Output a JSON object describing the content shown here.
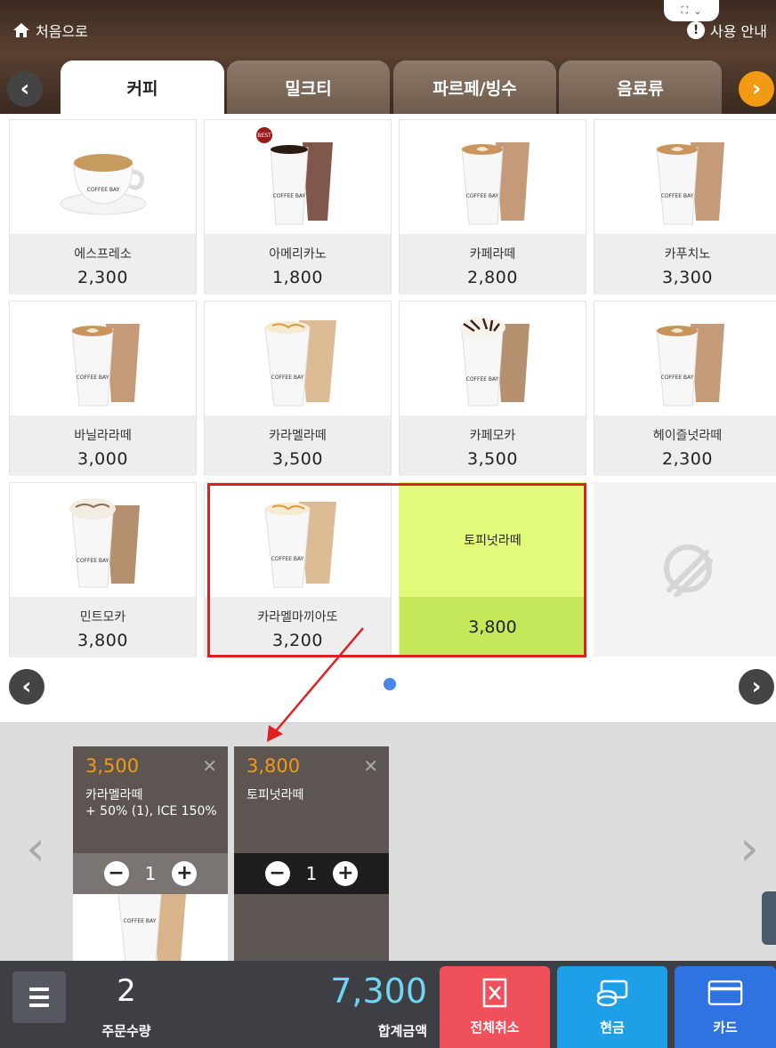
{
  "header": {
    "home_label": "처음으로",
    "help_label": "사용 안내"
  },
  "tabs": [
    {
      "label": "커피",
      "active": true
    },
    {
      "label": "밀크티",
      "active": false
    },
    {
      "label": "파르페/빙수",
      "active": false
    },
    {
      "label": "음료류",
      "active": false
    }
  ],
  "menu": {
    "items": [
      {
        "name": "에스프레소",
        "price": "2,300"
      },
      {
        "name": "아메리카노",
        "price": "1,800",
        "badge": "BEST"
      },
      {
        "name": "카페라떼",
        "price": "2,800"
      },
      {
        "name": "카푸치노",
        "price": "3,300"
      },
      {
        "name": "바닐라라떼",
        "price": "3,000"
      },
      {
        "name": "카라멜라떼",
        "price": "3,500"
      },
      {
        "name": "카페모카",
        "price": "3,500"
      },
      {
        "name": "헤이즐넛라떼",
        "price": "2,300"
      },
      {
        "name": "민트모카",
        "price": "3,800"
      },
      {
        "name": "카라멜마끼아또",
        "price": "3,200"
      },
      {
        "name": "토피넛라떼",
        "price": "3,800",
        "selected": true
      }
    ],
    "page_count": 1,
    "current_page": 1
  },
  "cart": {
    "items": [
      {
        "price": "3,500",
        "name": "카라멜라떼",
        "options": "+ 50% (1), ICE 150%",
        "qty": "1"
      },
      {
        "price": "3,800",
        "name": "토피넛라떼",
        "options": "",
        "qty": "1"
      }
    ]
  },
  "footer": {
    "order_qty": "2",
    "order_qty_label": "주문수량",
    "total": "7,300",
    "total_label": "합계금액",
    "cancel_all_label": "전체취소",
    "cash_label": "현금",
    "card_label": "카드"
  },
  "colors": {
    "header_brown": "#4a3528",
    "accent_orange": "#f29a12",
    "selected_green": "#e2fa7a",
    "cancel_red": "#f0505a",
    "cash_blue": "#1da0e8",
    "card_blue": "#2f73e0",
    "total_cyan": "#6fd6f2"
  }
}
